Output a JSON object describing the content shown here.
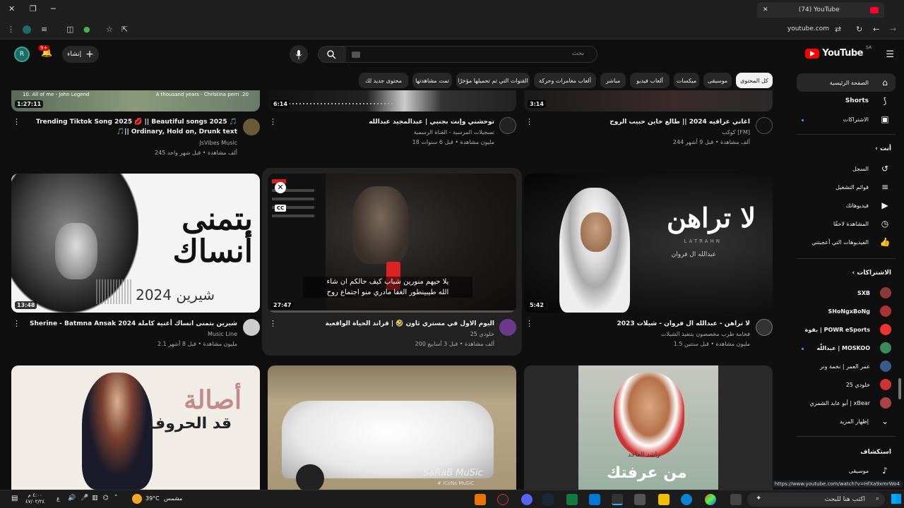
{
  "browser": {
    "tab_title": "(74) YouTube",
    "url": "youtube.com",
    "status_url": "https://www.youtube.com/watch?v=HfXa9xmrWo4"
  },
  "header": {
    "logo": "YouTube",
    "logo_region": "SA",
    "search_placeholder": "بحث",
    "create_label": "إنشاء",
    "notif_badge": "9+",
    "avatar_letter": "R"
  },
  "chips": [
    "كل المحتوى",
    "موسيقى",
    "ميكسات",
    "ألعاب فيديو",
    "مباشر",
    "ألعاب مغامرات وحركة",
    "القنوات التي تم تحميلها مؤخرًا",
    "تمت مشاهدتها",
    "محتوى جديد لك"
  ],
  "sidebar": {
    "top": [
      {
        "label": "الصفحة الرئيسية",
        "icon": "home-icon"
      },
      {
        "label": "Shorts",
        "icon": "shorts-icon"
      },
      {
        "label": "الاشتراكات",
        "icon": "subscriptions-icon"
      }
    ],
    "you_title": "أنت",
    "you": [
      {
        "label": "السجل",
        "icon": "history-icon"
      },
      {
        "label": "قوائم التشغيل",
        "icon": "playlist-icon"
      },
      {
        "label": "فيديوهاتك",
        "icon": "your-videos-icon"
      },
      {
        "label": "المشاهدة لاحقًا",
        "icon": "watch-later-icon"
      },
      {
        "label": "الفيديوهات التي أعجبتني",
        "icon": "like-icon"
      }
    ],
    "subs_title": "الاشتراكات",
    "subs": [
      {
        "label": "SXB",
        "color": "#8b3a3a"
      },
      {
        "label": "SHoNgxBoNg",
        "color": "#a33"
      },
      {
        "label": "بقوة | POWR eSports",
        "color": "#e33"
      },
      {
        "label": "عبداللّه | MOSKOO",
        "color": "#3a8a5a"
      },
      {
        "label": "عمر العمر | نخمة ونر",
        "color": "#3a5a8a"
      },
      {
        "label": "خلودي 25",
        "color": "#c33"
      },
      {
        "label": "أبو عابد الشمري | xBear",
        "color": "#a44"
      }
    ],
    "show_more": "إظهار المزيد",
    "explore_title": "استكشاف",
    "explore": [
      {
        "label": "موسيقى",
        "icon": "music-icon"
      }
    ]
  },
  "videos_top": [
    {
      "title_l1": "Trending Tiktok Song 2025 💋 || Beautiful songs 2025 🎵",
      "title_l2": "🎵|| Ordinary, Hold on, Drunk text",
      "channel": "JsVibes Music",
      "meta": "245 ألف مشاهدة • قبل شهر واحد",
      "duration": "1:27:11",
      "strip_left": "10. All of me - John Legend",
      "strip_right": "A thousand years - Christina perri .20"
    },
    {
      "title_l1": "توحشني وإنت بجنبي | عبدالمجيد عبدالله",
      "channel": "تسجيلات المرسية - القناة الرسمية",
      "meta": "18 مليون مشاهدة • قبل 6 سنوات",
      "duration": "6:14"
    },
    {
      "title_l1": "اغاني عراقيه 2024 || طالع خاين حبيب الروح",
      "channel": "كوكب [FM]",
      "meta": "244 ألف مشاهدة • قبل 9 أشهر",
      "duration": "3:14"
    }
  ],
  "videos_mid": [
    {
      "title": "Sherine - Batmna Ansak 2024 شيرين بتمنى انساك أغنية كاملة",
      "channel": "Music Line",
      "meta": "2.1 مليون مشاهدة • قبل 8 أشهر",
      "duration": "13:48",
      "thumb_big": "بتمنى",
      "thumb_big2": "أنساك",
      "thumb_small": "شيرين 2024"
    },
    {
      "title": "اليوم الاول في مستري ثاون 🤣 | قراند الحياة الواقعية",
      "channel": "خلودي 25",
      "meta": "200 ألف مشاهدة • قبل 3 أسابيع",
      "duration": "27:47",
      "sub_l1": "يلا حيهم منورين شباب كيف حالكم ان شاء",
      "sub_l2": "الله طيبينطور الغفا مادري منو اجتماع روح",
      "cc": "CC"
    },
    {
      "title": "لا تراهن - عبدالله ال فروان - شيلات 2023",
      "channel": "فخامة طرب مخصصون بتنفيذ الشيلات",
      "meta": "1.5 مليون مشاهدة • قبل سنتين",
      "duration": "5:42",
      "thumb_big": "لا تراهن",
      "thumb_sub": "LATRAHN",
      "thumb_small": "عبدالله ال فروان"
    }
  ],
  "videos_bottom": [
    {
      "thumb_big": "أصالة",
      "thumb_small": "قد الحروف"
    },
    {
      "watermark": "SaRaB MuSic",
      "watermark2": "# iCoNs MuSiC"
    },
    {
      "thumb_big": "من عرفتك",
      "thumb_small": "راشد الماجد"
    }
  ],
  "taskbar": {
    "search": "اكتب هنا للبحث",
    "weather": "39°C",
    "weather_label": "مشمس",
    "time": "٤:٠٠ م",
    "date": "٤٧/٠٢/٢٤",
    "lang": "ع"
  },
  "colors": {
    "accent": "#ff0000",
    "bg": "#0f0f0f",
    "chip": "#272727",
    "link": "#3ea6ff"
  }
}
